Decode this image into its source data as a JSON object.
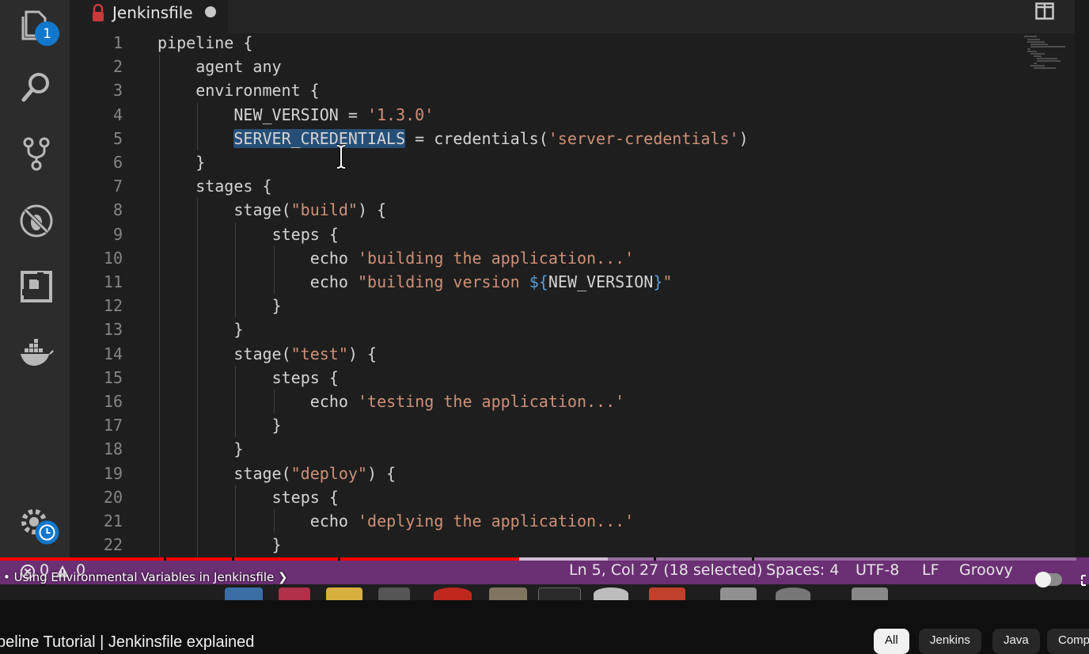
{
  "editor": {
    "tab": {
      "title": "Jenkinsfile",
      "modified": true
    },
    "explorer_badge": "1",
    "lines": [
      {
        "n": "1",
        "indent": 0,
        "parts": [
          {
            "t": "pipeline {",
            "c": ""
          }
        ]
      },
      {
        "n": "2",
        "indent": 1,
        "parts": [
          {
            "t": "agent any",
            "c": ""
          }
        ]
      },
      {
        "n": "3",
        "indent": 1,
        "parts": [
          {
            "t": "environment {",
            "c": ""
          }
        ]
      },
      {
        "n": "4",
        "indent": 2,
        "parts": [
          {
            "t": "NEW_VERSION = ",
            "c": ""
          },
          {
            "t": "'1.3.0'",
            "c": "str"
          }
        ]
      },
      {
        "n": "5",
        "indent": 2,
        "parts": [
          {
            "t": "SERVER_CREDENTIALS",
            "c": "sel"
          },
          {
            "t": " = credentials(",
            "c": ""
          },
          {
            "t": "'server-credentials'",
            "c": "str"
          },
          {
            "t": ")",
            "c": ""
          }
        ]
      },
      {
        "n": "6",
        "indent": 1,
        "parts": [
          {
            "t": "}",
            "c": ""
          }
        ]
      },
      {
        "n": "7",
        "indent": 1,
        "parts": [
          {
            "t": "stages {",
            "c": ""
          }
        ]
      },
      {
        "n": "8",
        "indent": 2,
        "parts": [
          {
            "t": "stage(",
            "c": ""
          },
          {
            "t": "\"build\"",
            "c": "str"
          },
          {
            "t": ") {",
            "c": ""
          }
        ]
      },
      {
        "n": "9",
        "indent": 3,
        "parts": [
          {
            "t": "steps {",
            "c": ""
          }
        ]
      },
      {
        "n": "10",
        "indent": 4,
        "parts": [
          {
            "t": "echo ",
            "c": ""
          },
          {
            "t": "'building the application...'",
            "c": "str"
          }
        ]
      },
      {
        "n": "11",
        "indent": 4,
        "parts": [
          {
            "t": "echo ",
            "c": ""
          },
          {
            "t": "\"building version ",
            "c": "str"
          },
          {
            "t": "${",
            "c": "tplv"
          },
          {
            "t": "NEW_VERSION",
            "c": ""
          },
          {
            "t": "}",
            "c": "tplv"
          },
          {
            "t": "\"",
            "c": "str"
          }
        ]
      },
      {
        "n": "12",
        "indent": 3,
        "parts": [
          {
            "t": "}",
            "c": ""
          }
        ]
      },
      {
        "n": "13",
        "indent": 2,
        "parts": [
          {
            "t": "}",
            "c": ""
          }
        ]
      },
      {
        "n": "14",
        "indent": 2,
        "parts": [
          {
            "t": "stage(",
            "c": ""
          },
          {
            "t": "\"test\"",
            "c": "str"
          },
          {
            "t": ") {",
            "c": ""
          }
        ]
      },
      {
        "n": "15",
        "indent": 3,
        "parts": [
          {
            "t": "steps {",
            "c": ""
          }
        ]
      },
      {
        "n": "16",
        "indent": 4,
        "parts": [
          {
            "t": "echo ",
            "c": ""
          },
          {
            "t": "'testing the application...'",
            "c": "str"
          }
        ]
      },
      {
        "n": "17",
        "indent": 3,
        "parts": [
          {
            "t": "}",
            "c": ""
          }
        ]
      },
      {
        "n": "18",
        "indent": 2,
        "parts": [
          {
            "t": "}",
            "c": ""
          }
        ]
      },
      {
        "n": "19",
        "indent": 2,
        "parts": [
          {
            "t": "stage(",
            "c": ""
          },
          {
            "t": "\"deploy\"",
            "c": "str"
          },
          {
            "t": ") {",
            "c": ""
          }
        ]
      },
      {
        "n": "20",
        "indent": 3,
        "parts": [
          {
            "t": "steps {",
            "c": ""
          }
        ]
      },
      {
        "n": "21",
        "indent": 4,
        "parts": [
          {
            "t": "echo ",
            "c": ""
          },
          {
            "t": "'deplying the application...'",
            "c": "str"
          }
        ]
      },
      {
        "n": "22",
        "indent": 3,
        "parts": [
          {
            "t": "}",
            "c": ""
          }
        ]
      }
    ],
    "colors": {
      "string": "#ce9178",
      "template": "#569cd6",
      "selection": "#264f78",
      "text": "#d4d4d4",
      "line_number": "#858585"
    }
  },
  "activity_icons": [
    "files-icon",
    "search-icon",
    "source-control-icon",
    "debug-icon",
    "extensions-icon",
    "docker-icon",
    "settings-icon"
  ],
  "statusbar": {
    "errors": "0",
    "warnings": "0",
    "position": "Ln 5, Col 27 (18 selected)",
    "spaces": "Spaces: 4",
    "encoding": "UTF-8",
    "eol": "LF",
    "language": "Groovy",
    "color": "#6b2f74"
  },
  "player": {
    "chapter": "• Using Environmental Variables in Jenkinsfile",
    "progress_played": 0.477,
    "progress_loaded": 0.558
  },
  "youtube": {
    "video_title": "peline Tutorial | Jenkinsfile explained",
    "chips": [
      "All",
      "Jenkins",
      "Java",
      "Comp"
    ]
  }
}
